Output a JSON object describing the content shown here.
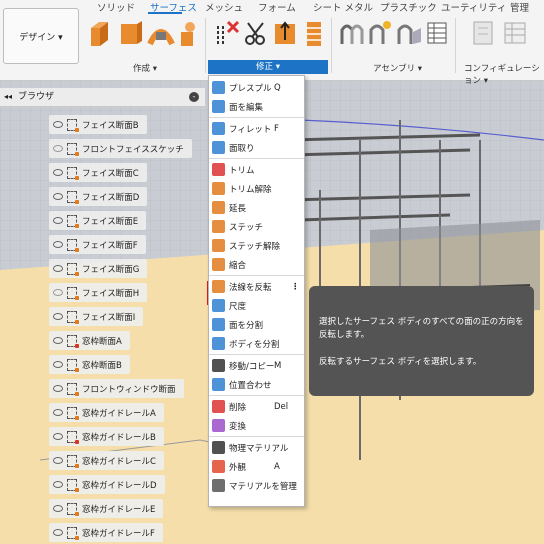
{
  "tabs": [
    "ソリッド",
    "サーフェス",
    "メッシュ",
    "フォーム",
    "シート メタル",
    "プラスチック",
    "ユーティリティ",
    "管理"
  ],
  "design_button": "デザイン ▾",
  "groups": {
    "create": "作成 ▾",
    "modify": "修正 ▾",
    "assemble": "アセンブリ ▾",
    "config": "コンフィギュレーション ▾"
  },
  "browser": {
    "title": "ブラウザ",
    "items": [
      {
        "label": "フェイス断面B",
        "visible": true,
        "lock": false
      },
      {
        "label": "フロントフェイススケッチ",
        "visible": false,
        "lock": false
      },
      {
        "label": "フェイス断面C",
        "visible": true,
        "lock": false
      },
      {
        "label": "フェイス断面D",
        "visible": true,
        "lock": false
      },
      {
        "label": "フェイス断面E",
        "visible": true,
        "lock": false
      },
      {
        "label": "フェイス断面F",
        "visible": true,
        "lock": false
      },
      {
        "label": "フェイス断面G",
        "visible": true,
        "lock": false
      },
      {
        "label": "フェイス断面H",
        "visible": false,
        "lock": false
      },
      {
        "label": "フェイス断面I",
        "visible": true,
        "lock": false
      },
      {
        "label": "窓枠断面A",
        "visible": true,
        "lock": true
      },
      {
        "label": "窓枠断面B",
        "visible": true,
        "lock": false
      },
      {
        "label": "フロントウィンドウ断面",
        "visible": true,
        "lock": false
      },
      {
        "label": "窓枠ガイドレールA",
        "visible": true,
        "lock": false
      },
      {
        "label": "窓枠ガイドレールB",
        "visible": true,
        "lock": true
      },
      {
        "label": "窓枠ガイドレールC",
        "visible": true,
        "lock": false
      },
      {
        "label": "窓枠ガイドレールD",
        "visible": true,
        "lock": false
      },
      {
        "label": "窓枠ガイドレールE",
        "visible": true,
        "lock": false
      },
      {
        "label": "窓枠ガイドレールF",
        "visible": true,
        "lock": false
      }
    ]
  },
  "menu": {
    "items": [
      {
        "label": "プレスプル",
        "shortcut": "Q",
        "icon": "press-pull-icon",
        "color": "#2f7fd1"
      },
      {
        "label": "面を編集",
        "shortcut": "",
        "icon": "edit-face-icon",
        "color": "#2f7fd1"
      },
      {
        "label": "フィレット",
        "shortcut": "F",
        "icon": "fillet-icon",
        "color": "#2f7fd1"
      },
      {
        "label": "面取り",
        "shortcut": "",
        "icon": "chamfer-icon",
        "color": "#2f7fd1"
      },
      {
        "label": "トリム",
        "shortcut": "",
        "icon": "trim-icon",
        "color": "#d33"
      },
      {
        "label": "トリム解除",
        "shortcut": "",
        "icon": "untrim-icon",
        "color": "#e07a1d"
      },
      {
        "label": "延長",
        "shortcut": "",
        "icon": "extend-icon",
        "color": "#e07a1d"
      },
      {
        "label": "ステッチ",
        "shortcut": "",
        "icon": "stitch-icon",
        "color": "#e07a1d"
      },
      {
        "label": "ステッチ解除",
        "shortcut": "",
        "icon": "unstitch-icon",
        "color": "#e07a1d"
      },
      {
        "label": "縮合",
        "shortcut": "",
        "icon": "reduce-icon",
        "color": "#e07a1d"
      },
      {
        "label": "法線を反転",
        "shortcut": "",
        "icon": "reverse-normal-icon",
        "color": "#e07a1d"
      },
      {
        "label": "尺度",
        "shortcut": "",
        "icon": "scale-icon",
        "color": "#2f7fd1"
      },
      {
        "label": "面を分割",
        "shortcut": "",
        "icon": "split-face-icon",
        "color": "#2f7fd1"
      },
      {
        "label": "ボディを分割",
        "shortcut": "",
        "icon": "split-body-icon",
        "color": "#2f7fd1"
      },
      {
        "label": "移動/コピー",
        "shortcut": "M",
        "icon": "move-icon",
        "color": "#333"
      },
      {
        "label": "位置合わせ",
        "shortcut": "",
        "icon": "align-icon",
        "color": "#2f7fd1"
      },
      {
        "label": "削除",
        "shortcut": "Del",
        "icon": "delete-icon",
        "color": "#d33"
      },
      {
        "label": "変換",
        "shortcut": "",
        "icon": "convert-icon",
        "color": "#9b4dc8"
      },
      {
        "label": "物理マテリアル",
        "shortcut": "",
        "icon": "physical-material-icon",
        "color": "#333"
      },
      {
        "label": "外観",
        "shortcut": "A",
        "icon": "appearance-icon",
        "color": "#e04a2d"
      },
      {
        "label": "マテリアルを管理",
        "shortcut": "",
        "icon": "manage-materials-icon",
        "color": "#555"
      }
    ]
  },
  "tooltip": {
    "line1": "選択したサーフェス ボディのすべての面の正の方向を反転します。",
    "line2": "反転するサーフェス ボディを選択します。"
  },
  "colors": {
    "accent": "#1d73c5",
    "highlight_border": "#e0191f",
    "tooltip_bg": "#545454",
    "ground": "#f6deaa"
  }
}
